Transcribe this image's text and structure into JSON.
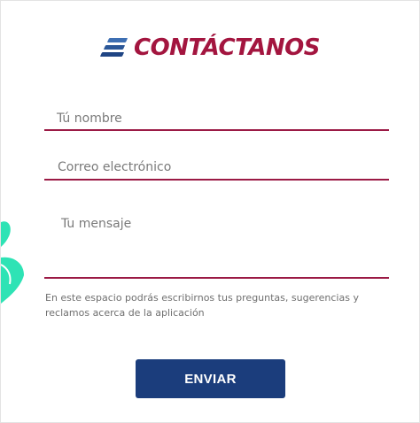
{
  "header": {
    "logo_icon": "stacked-stripes-icon",
    "title": "CONTÁCTANOS"
  },
  "form": {
    "name_placeholder": "Tú nombre",
    "email_placeholder": "Correo electrónico",
    "message_placeholder": "Tu mensaje",
    "helper_text": "En este espacio podrás escribirnos tus preguntas, sugerencias y reclamos acerca de la aplicación",
    "submit_label": "ENVIAR"
  },
  "decor": {
    "leaf_icon": "leaf-decoration-icon"
  },
  "colors": {
    "brand_red": "#a3153f",
    "brand_blue": "#1b3d7c",
    "underline": "#9b1a45",
    "leaf": "#2ee3b5"
  }
}
